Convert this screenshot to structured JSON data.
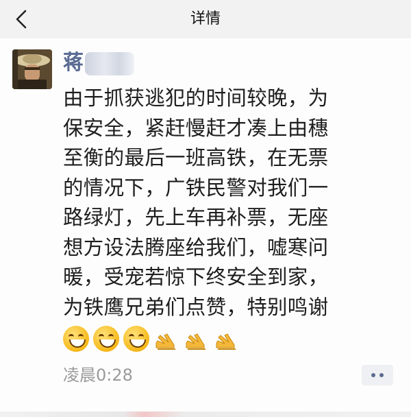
{
  "nav": {
    "title": "详情",
    "back_icon": "chevron-left-icon"
  },
  "post": {
    "author_name": "蒋",
    "content_lines": [
      "由于抓获逃犯的时间较晚，为",
      "保安全，紧赶慢赶才凑上由穗",
      "至衡的最后一班高铁，在无票",
      "的情况下，广铁民警对我们一",
      "路绿灯，先上车再补票，无座",
      "想方设法腾座给我们，嘘寒问",
      "暖，受宠若惊下终安全到家，",
      "为铁鹰兄弟们点赞，特别鸣谢"
    ],
    "emojis": [
      "smile-icon",
      "smile-icon",
      "smile-icon",
      "clap-icon",
      "clap-icon",
      "clap-icon"
    ],
    "timestamp": "凌晨0:28",
    "more_icon": "more-dots-icon"
  },
  "colors": {
    "author_name": "#5a6b93",
    "nav_background": "#f2f2f2",
    "timestamp": "#9a9a9a"
  }
}
